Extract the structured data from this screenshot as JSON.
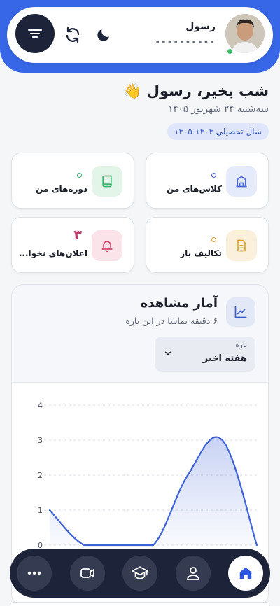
{
  "header": {
    "user_name": "رسول",
    "user_masked": "••••••••••",
    "icons": [
      "menu-icon",
      "refresh-icon",
      "moon-icon"
    ]
  },
  "greeting": {
    "title": "شب بخیر، رسول 👋",
    "date": "سه‌شنبه ۲۴ شهریور ۱۴۰۵",
    "academic_year": "سال تحصیلی ۱۴۰۴-۱۴۰۵"
  },
  "stats": [
    {
      "label": "کلاس‌های من",
      "icon": "building-icon",
      "color": "#4a63d8",
      "count": ""
    },
    {
      "label": "دوره‌های من",
      "icon": "book-icon",
      "color": "#3cb371",
      "count": ""
    },
    {
      "label": "تکالیف باز",
      "icon": "document-icon",
      "color": "#e3a221",
      "count": ""
    },
    {
      "label": "اعلان‌های نخوا...",
      "icon": "bell-icon",
      "color": "#d9466f",
      "count": "۳"
    }
  ],
  "views": {
    "title": "آمار مشاهده",
    "subtitle": "۶ دقیقه تماشا در این بازه",
    "range_label": "بازه",
    "range_value": "هفته اخیر"
  },
  "chart_data": {
    "type": "area",
    "x": [
      0,
      1,
      2,
      3,
      4,
      5,
      6
    ],
    "values": [
      1,
      0,
      0,
      0,
      2,
      3,
      0
    ],
    "ylim": [
      0,
      4
    ],
    "yticks": [
      "0",
      "1",
      "2",
      "3",
      "4"
    ],
    "color": "#3d63d6",
    "grid": true
  },
  "nav": {
    "items": [
      "more-icon",
      "video-icon",
      "graduation-cap-icon",
      "user-icon",
      "home-icon"
    ],
    "active": "home-icon"
  }
}
